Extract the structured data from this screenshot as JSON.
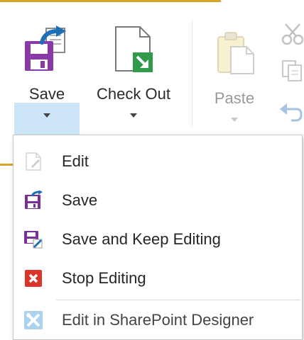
{
  "ribbon": {
    "save_label": "Save",
    "checkout_label": "Check Out",
    "paste_label": "Paste"
  },
  "menu": {
    "items": [
      {
        "label": "Edit",
        "icon": "edit-page-icon"
      },
      {
        "label": "Save",
        "icon": "save-icon"
      },
      {
        "label": "Save and Keep Editing",
        "icon": "save-keep-editing-icon"
      },
      {
        "label": "Stop Editing",
        "icon": "stop-editing-icon"
      },
      {
        "label": "Edit in SharePoint Designer",
        "icon": "sharepoint-designer-icon"
      }
    ]
  },
  "colors": {
    "accent_orange": "#d9a42a",
    "save_purple": "#8a3aa8",
    "checkout_green": "#2e9a4a",
    "stop_red": "#d9352a",
    "dropdown_highlight": "#cde6f7",
    "arrow_blue": "#1e6fb8"
  }
}
